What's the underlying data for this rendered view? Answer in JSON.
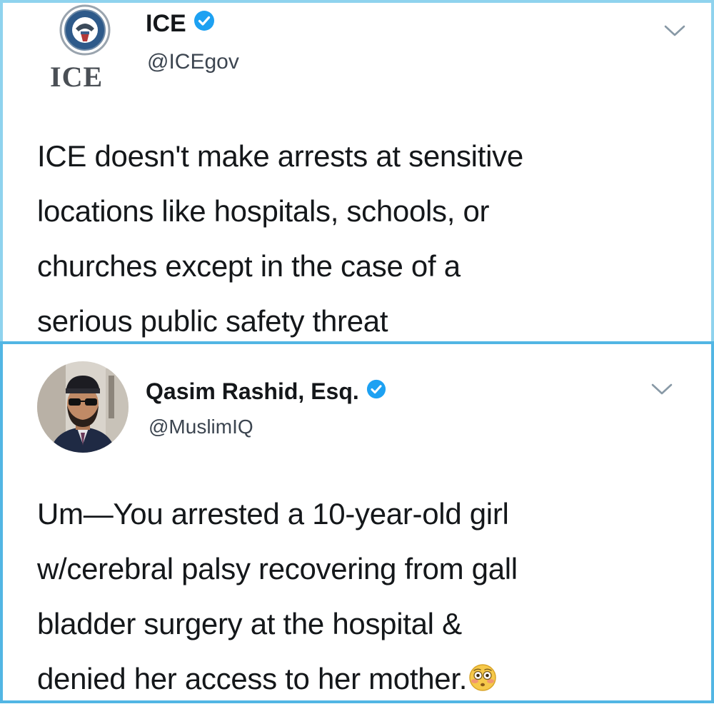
{
  "tweets": [
    {
      "display_name": "ICE",
      "handle": "@ICEgov",
      "logo_text": "ICE",
      "avatar_icon": "dhs-seal-icon",
      "verified": true,
      "lines": [
        "ICE doesn't make arrests at sensitive",
        "locations like hospitals, schools, or",
        "churches except in the case of a",
        "serious public safety threat"
      ]
    },
    {
      "display_name": "Qasim Rashid, Esq.",
      "handle": "@MuslimIQ",
      "avatar_icon": "profile-photo-avatar",
      "verified": true,
      "lines": [
        "Um—You arrested a 10-year-old girl",
        "w/cerebral palsy recovering from gall",
        "bladder surgery at the hospital &",
        "denied her access to her mother."
      ],
      "trailing_emoji": "flushed-face-emoji"
    }
  ],
  "colors": {
    "verified_blue": "#1da1f2",
    "border_top": "#8fd3ee",
    "border_bottom": "#52b6e4",
    "text": "#14171a",
    "handle": "#3c4550"
  }
}
